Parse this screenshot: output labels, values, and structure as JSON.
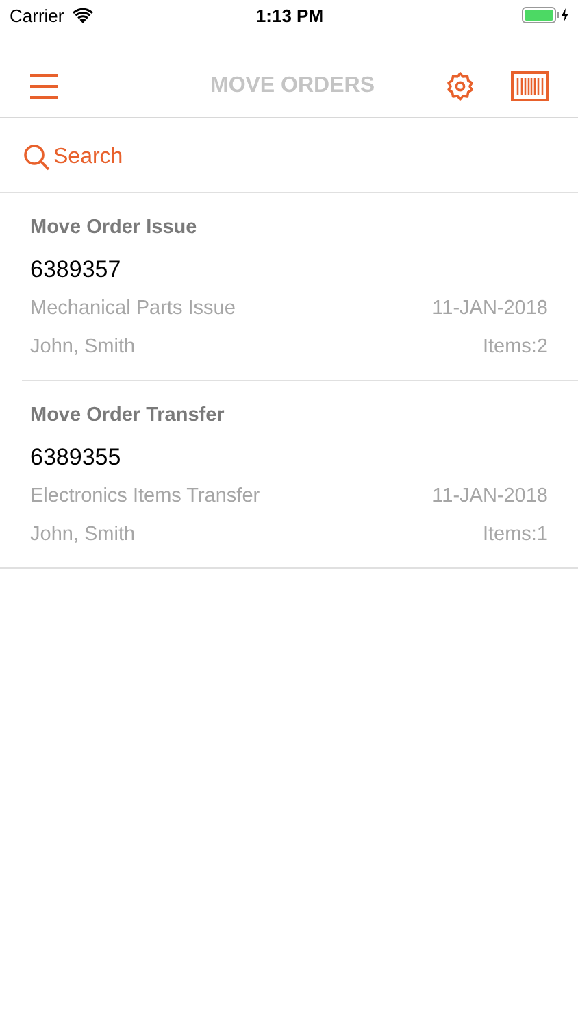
{
  "status_bar": {
    "carrier": "Carrier",
    "time": "1:13 PM"
  },
  "nav_bar": {
    "title": "MOVE ORDERS"
  },
  "search": {
    "placeholder": "Search"
  },
  "orders": [
    {
      "type": "Move Order Issue",
      "number": "6389357",
      "description": "Mechanical Parts Issue",
      "date": "11-JAN-2018",
      "requester": "John, Smith",
      "items": "Items:2"
    },
    {
      "type": "Move Order Transfer",
      "number": "6389355",
      "description": "Electronics Items Transfer",
      "date": "11-JAN-2018",
      "requester": "John, Smith",
      "items": "Items:1"
    }
  ]
}
